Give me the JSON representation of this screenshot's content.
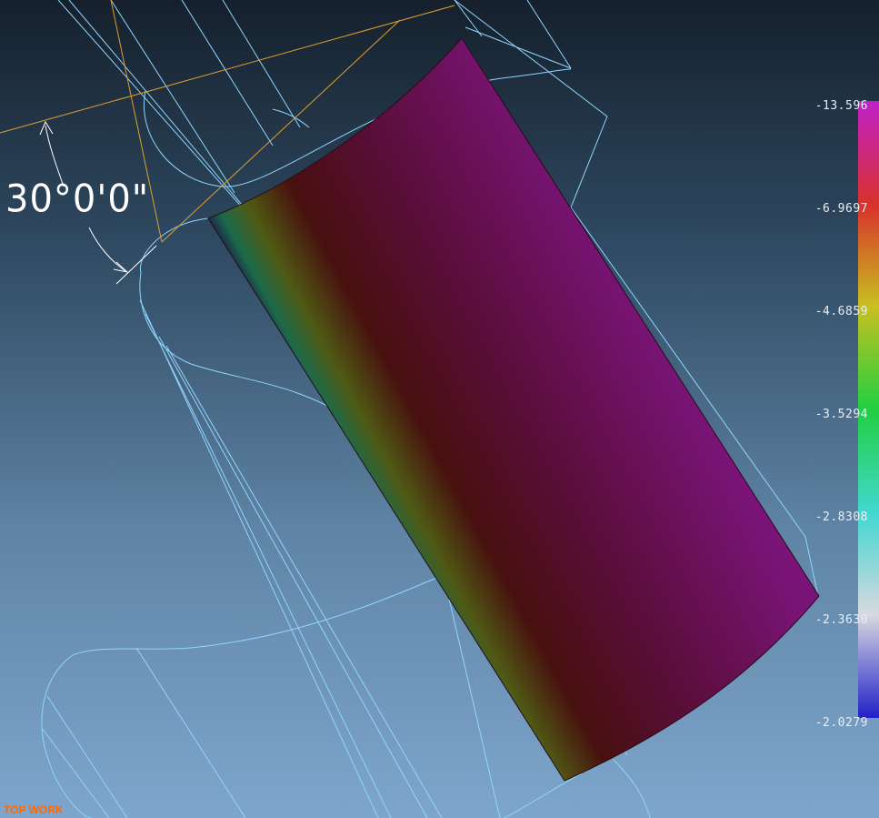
{
  "viewport": {
    "view_name": "TOP WORK",
    "angle_annotation": "30°0'0\""
  },
  "legend": {
    "ticks": [
      "-13.596",
      "-6.9697",
      "-4.6859",
      "-3.5294",
      "-2.8308",
      "-2.3630",
      "-2.0279"
    ],
    "colors": [
      "#c020c8",
      "#d8302c",
      "#c8c020",
      "#20d040",
      "#40d8d0",
      "#d8d8e0",
      "#2020c8"
    ]
  },
  "colors": {
    "wireframe": "#8fd6ff",
    "dimension_lines": "#e0a030",
    "surface_top": "#7a1478",
    "surface_mid": "#4a0c12",
    "surface_edge_green": "#4f5a14",
    "view_label": "#ff6a00"
  }
}
